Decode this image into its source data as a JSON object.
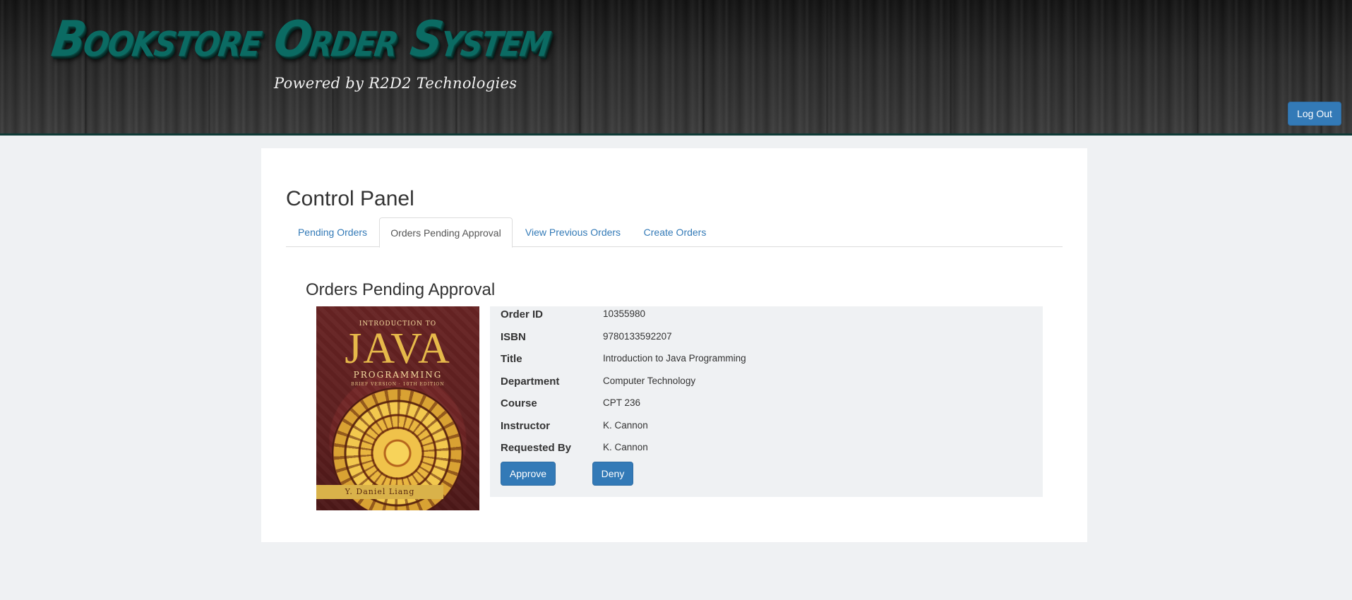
{
  "header": {
    "app_title": "Bookstore Order System",
    "subtitle": "Powered by R2D2 Technologies",
    "logout_label": "Log Out"
  },
  "main": {
    "page_title": "Control Panel",
    "tabs": [
      {
        "label": "Pending Orders",
        "active": false
      },
      {
        "label": "Orders Pending Approval",
        "active": true
      },
      {
        "label": "View Previous Orders",
        "active": false
      },
      {
        "label": "Create Orders",
        "active": false
      }
    ],
    "section_title": "Orders Pending Approval"
  },
  "order": {
    "cover": {
      "intro_text": "INTRODUCTION TO",
      "title_text": "JAVA",
      "subtitle_text": "PROGRAMMING",
      "edition_text": "BRIEF VERSION · 10TH EDITION",
      "author_text": "Y. Daniel Liang"
    },
    "fields": [
      {
        "label": "Order ID",
        "value": "10355980"
      },
      {
        "label": "ISBN",
        "value": "9780133592207"
      },
      {
        "label": "Title",
        "value": "Introduction to Java Programming"
      },
      {
        "label": "Department",
        "value": "Computer Technology"
      },
      {
        "label": "Course",
        "value": "CPT 236"
      },
      {
        "label": "Instructor",
        "value": "K. Cannon"
      },
      {
        "label": "Requested By",
        "value": "K. Cannon"
      }
    ],
    "approve_label": "Approve",
    "deny_label": "Deny"
  },
  "colors": {
    "accent": "#337ab7",
    "logo": "#0b6b63",
    "page_background": "#eff1f3"
  }
}
